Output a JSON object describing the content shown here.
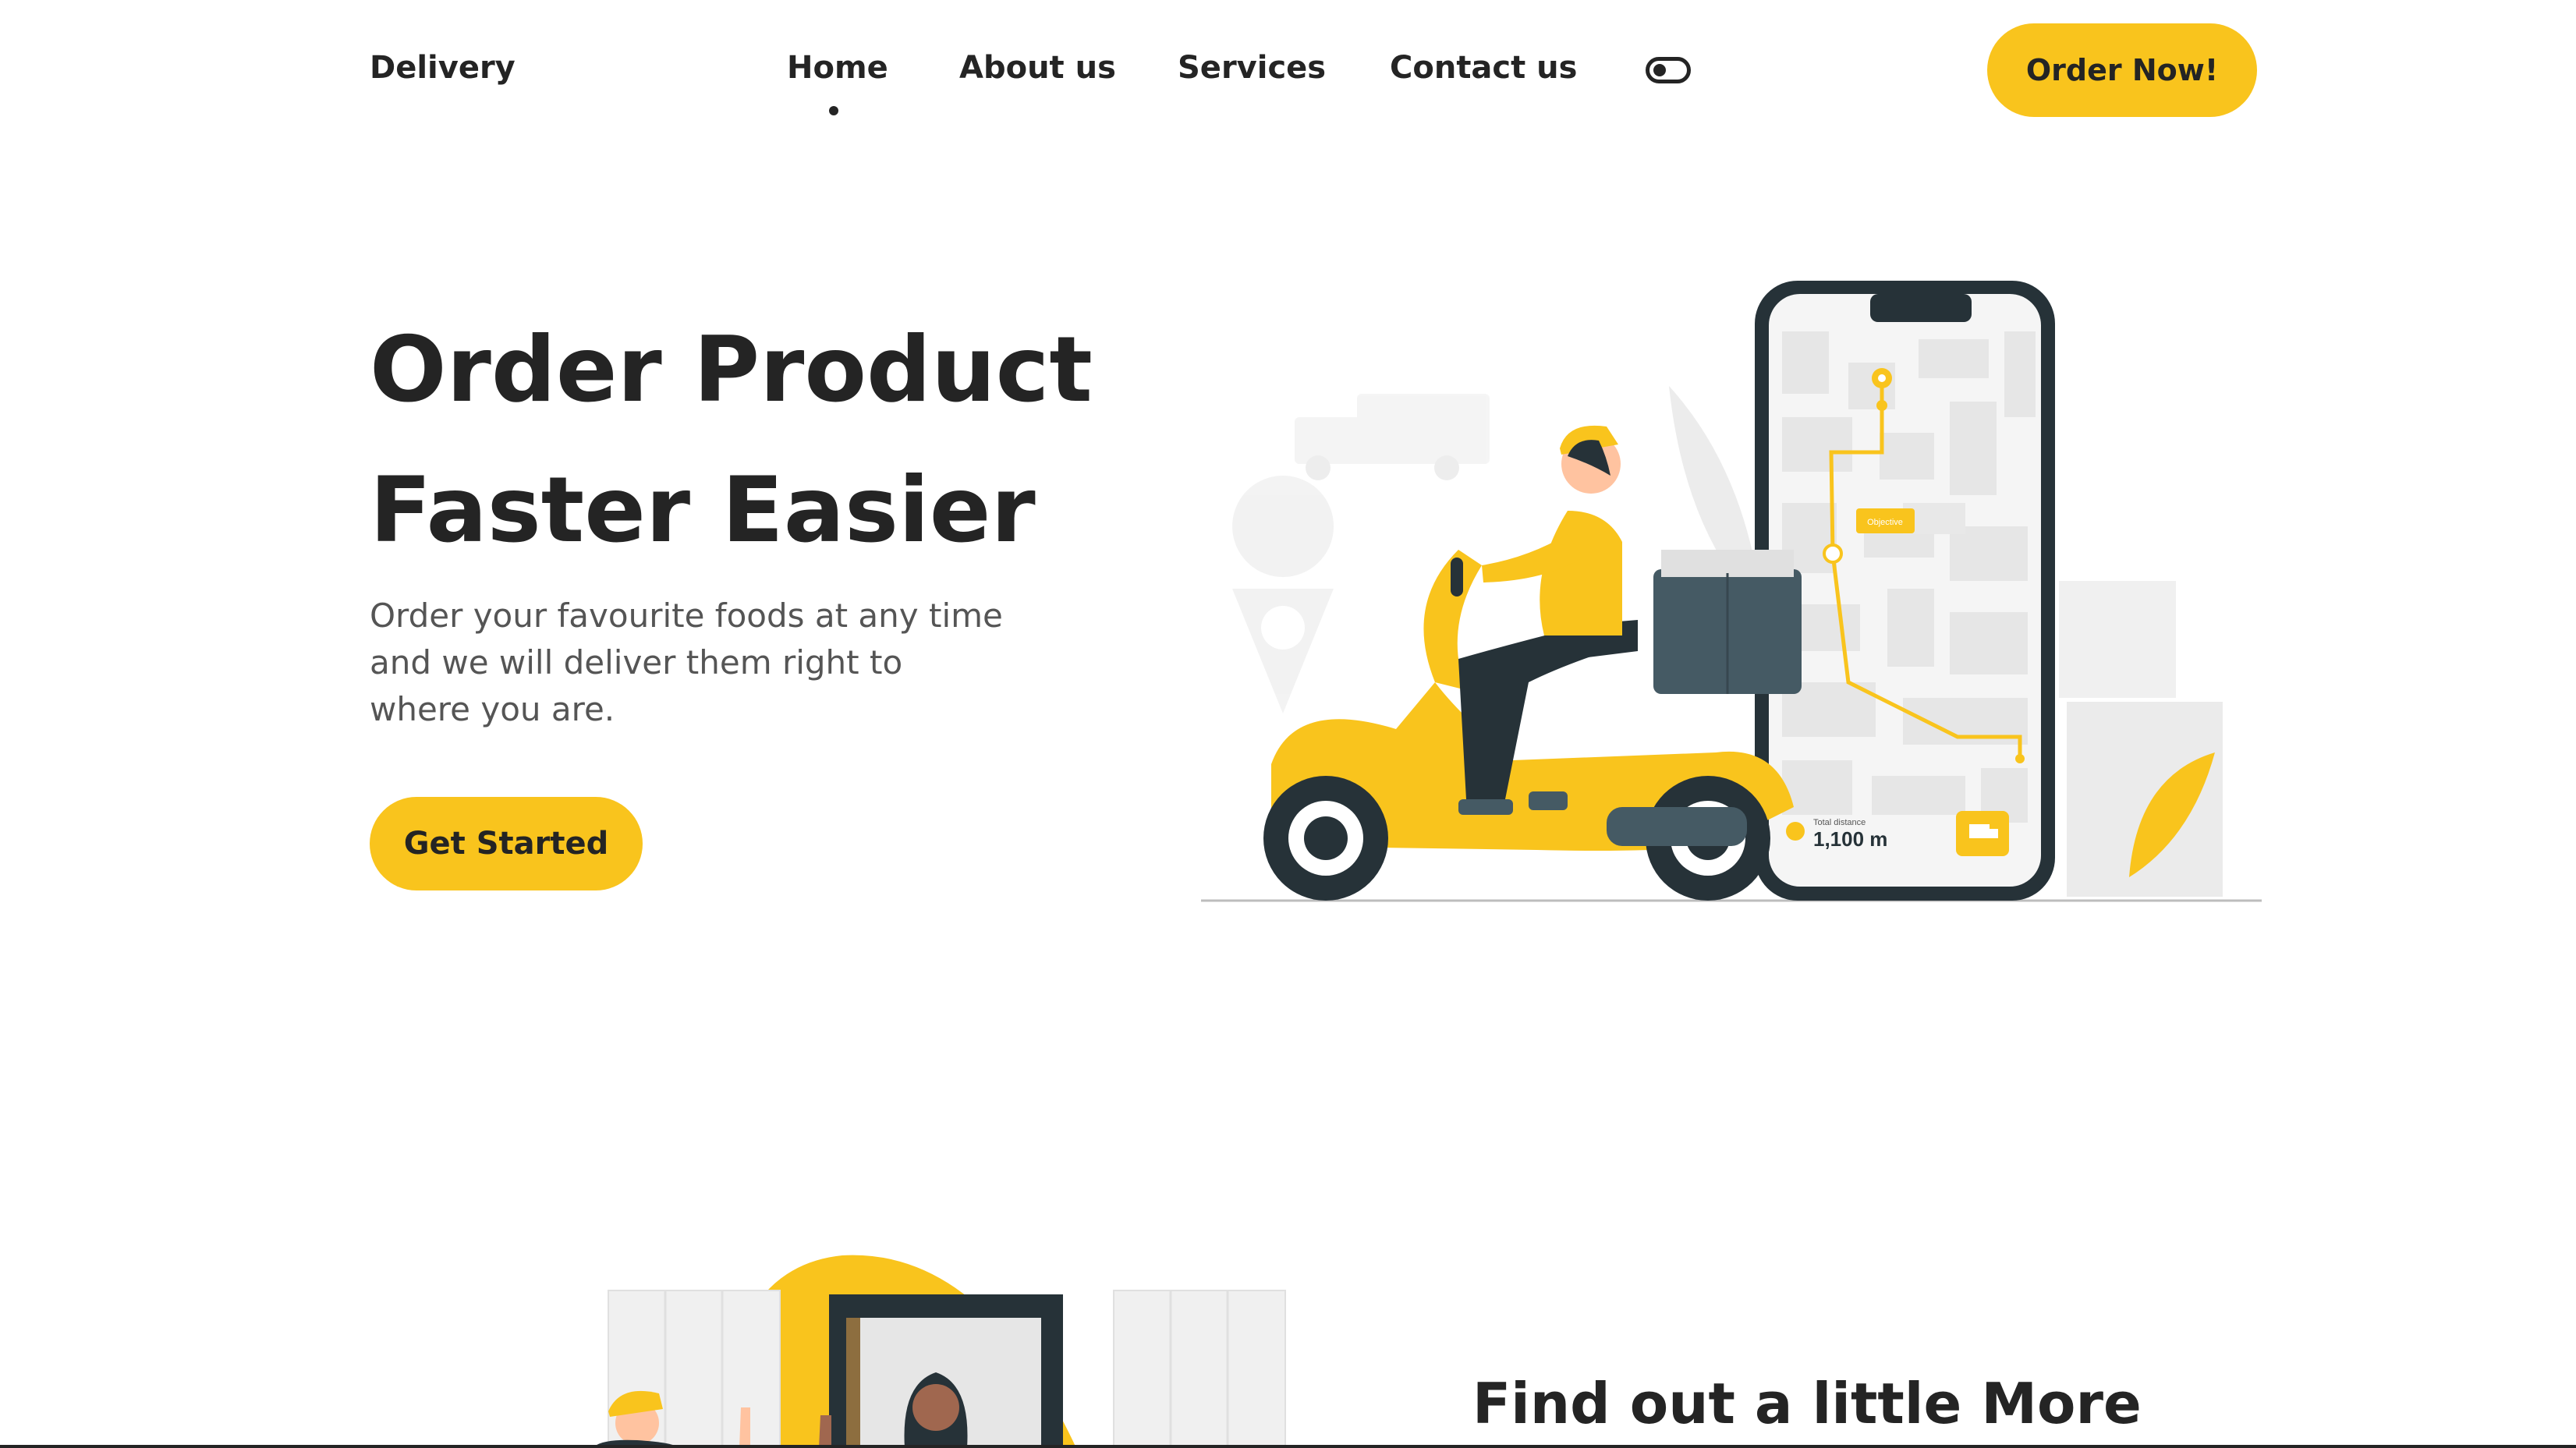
{
  "nav": {
    "logo": "Delivery",
    "items": [
      {
        "label": "Home",
        "active": true
      },
      {
        "label": "About us",
        "active": false
      },
      {
        "label": "Services",
        "active": false
      },
      {
        "label": "Contact us",
        "active": false
      }
    ],
    "theme_toggle_icon": "toggle-icon",
    "order_button": "Order Now!"
  },
  "hero": {
    "title_line1": "Order Product",
    "title_line2": "Faster Easier",
    "description": "Order your favourite foods at any time and we will deliver them right to where you are.",
    "cta": "Get Started",
    "illustration": {
      "map_label": "Objective",
      "distance_label": "Total distance",
      "distance_value": "1,100 m"
    }
  },
  "more": {
    "title": "Find out a little More"
  },
  "colors": {
    "accent": "#f9c41d",
    "text": "#242424",
    "muted": "#555555",
    "dark": "#263238"
  }
}
